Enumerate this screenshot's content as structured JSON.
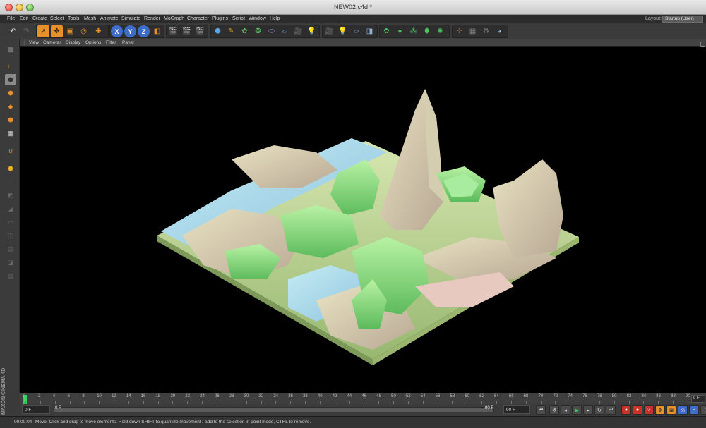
{
  "window": {
    "title": "NEW02.c4d *"
  },
  "menu": {
    "items": [
      "File",
      "Edit",
      "Create",
      "Select",
      "Tools",
      "Mesh",
      "Animate",
      "Simulate",
      "Render",
      "MoGraph",
      "Character",
      "Plugins",
      "Script",
      "Window",
      "Help"
    ],
    "layout_label": "Layout:",
    "layout_value": "Startup (User)"
  },
  "toolbar": {
    "axis_x": "X",
    "axis_y": "Y",
    "axis_z": "Z",
    "icons": [
      "undo-icon",
      "redo-icon",
      "live-selection-icon",
      "move-icon",
      "scale-icon",
      "rotate-icon",
      "add-icon",
      "x-axis-icon",
      "y-axis-icon",
      "z-axis-icon",
      "coordinate-system-icon",
      "render-view-icon",
      "render-picture-viewer-icon",
      "render-settings-icon",
      "cube-icon",
      "spline-pen-icon",
      "subdivision-surface-icon",
      "array-icon",
      "deformer-icon",
      "floor-icon",
      "camera-icon",
      "light-icon",
      "scene-camera-icon",
      "sky-icon",
      "background-icon",
      "environment-icon",
      "mograph-cloner-icon",
      "mograph-effector-icon",
      "mograph-fracture-icon",
      "mograph-matrix-icon",
      "mograph-text-icon",
      "hair-icon",
      "sketch-icon",
      "python-icon"
    ]
  },
  "sidebar": {
    "icons": [
      "make-editable-icon",
      "axis-mode-icon",
      "model-mode-icon",
      "object-mode-icon",
      "texture-mode-icon",
      "point-mode-icon",
      "edge-mode-icon",
      "polygon-mode-icon",
      "uv-mode-icon",
      "workplane-icon",
      "snap-icon",
      "lock-icon",
      "solo-icon"
    ]
  },
  "viewport": {
    "menu": [
      "View",
      "Cameras",
      "Display",
      "Options",
      "Filter",
      "Panel"
    ]
  },
  "timeline": {
    "ticks": [
      "0",
      "2",
      "4",
      "6",
      "8",
      "10",
      "12",
      "14",
      "16",
      "18",
      "20",
      "22",
      "24",
      "26",
      "28",
      "30",
      "32",
      "34",
      "36",
      "38",
      "40",
      "42",
      "44",
      "46",
      "48",
      "50",
      "52",
      "54",
      "56",
      "58",
      "60",
      "62",
      "64",
      "66",
      "68",
      "70",
      "72",
      "74",
      "76",
      "78",
      "80",
      "82",
      "84",
      "86",
      "88",
      "90"
    ],
    "current_frame": "0 F",
    "playhead_frame": 0
  },
  "transport": {
    "start_field": "0 F",
    "range_start": "0 F",
    "range_end": "90 F",
    "end_field": "90 F",
    "buttons": [
      "go-to-start-icon",
      "previous-key-icon",
      "previous-frame-icon",
      "play-icon",
      "next-frame-icon",
      "next-key-icon",
      "go-to-end-icon"
    ],
    "record_buttons": [
      "record-active-objects-icon",
      "autokeying-icon",
      "keyframe-selection-icon",
      "position-key-icon",
      "scale-key-icon",
      "rotation-key-icon",
      "parameter-key-icon",
      "point-level-animation-icon"
    ]
  },
  "status": {
    "time": "00:00:04",
    "message": "Move: Click and drag to move elements. Hold down SHIFT to quantize movement / add to the selection in point mode, CTRL to remove."
  },
  "brand": {
    "logo": "MAXON CINEMA 4D"
  },
  "colors": {
    "accent_orange": "#e8902a",
    "axis_blue": "#3d6cc9",
    "play_green": "#3cd060",
    "record_red": "#c8322a",
    "terrain_grass": "#7fd27a",
    "terrain_water": "#9bd3e6",
    "terrain_rock": "#cdb9a4"
  }
}
